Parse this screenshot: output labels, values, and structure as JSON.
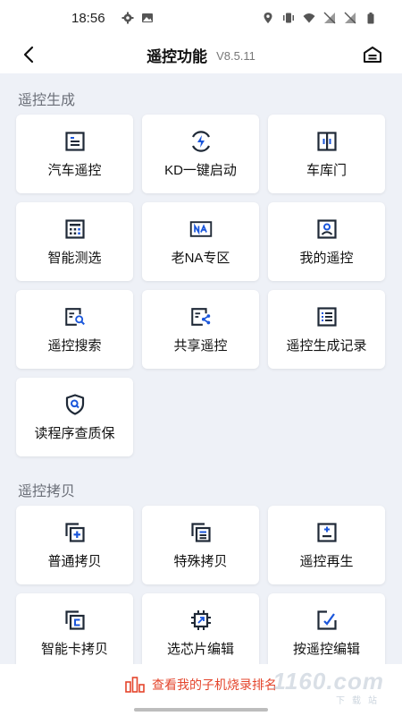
{
  "status": {
    "time": "18:56",
    "left_icons": [
      "gear-icon",
      "image-icon"
    ],
    "right_icons": [
      "location-icon",
      "vibrate-icon",
      "wifi-icon",
      "signal-off-icon",
      "signal-off-icon",
      "battery-icon"
    ]
  },
  "header": {
    "title": "遥控功能",
    "version": "V8.5.11",
    "back_icon": "back-arrow-icon",
    "home_icon": "home-icon"
  },
  "sections": [
    {
      "title": "遥控生成",
      "items": [
        {
          "label": "汽车遥控",
          "icon": "car-remote-icon"
        },
        {
          "label": "KD一键启动",
          "icon": "bolt-icon"
        },
        {
          "label": "车库门",
          "icon": "garage-door-icon"
        },
        {
          "label": "智能测选",
          "icon": "calculator-icon"
        },
        {
          "label": "老NA专区",
          "icon": "na-icon"
        },
        {
          "label": "我的遥控",
          "icon": "person-icon"
        },
        {
          "label": "遥控搜索",
          "icon": "search-doc-icon"
        },
        {
          "label": "共享遥控",
          "icon": "share-icon"
        },
        {
          "label": "遥控生成记录",
          "icon": "list-icon"
        },
        {
          "label": "读程序查质保",
          "icon": "shield-search-icon"
        }
      ]
    },
    {
      "title": "遥控拷贝",
      "items": [
        {
          "label": "普通拷贝",
          "icon": "copy-plus-icon"
        },
        {
          "label": "特殊拷贝",
          "icon": "copy-list-icon"
        },
        {
          "label": "遥控再生",
          "icon": "regenerate-icon"
        },
        {
          "label": "智能卡拷贝",
          "icon": "card-copy-icon"
        },
        {
          "label": "选芯片编辑",
          "icon": "chip-icon"
        },
        {
          "label": "按遥控编辑",
          "icon": "edit-icon"
        }
      ]
    }
  ],
  "bottom": {
    "text": "查看我的子机烧录排名",
    "icon": "bar-chart-icon",
    "watermark": "1160.com",
    "watermark_sub": "下载站"
  },
  "colors": {
    "accent": "#1a56db",
    "icon_dark": "#1f2937",
    "rank_red": "#e4452c",
    "background": "#eef1f7"
  }
}
